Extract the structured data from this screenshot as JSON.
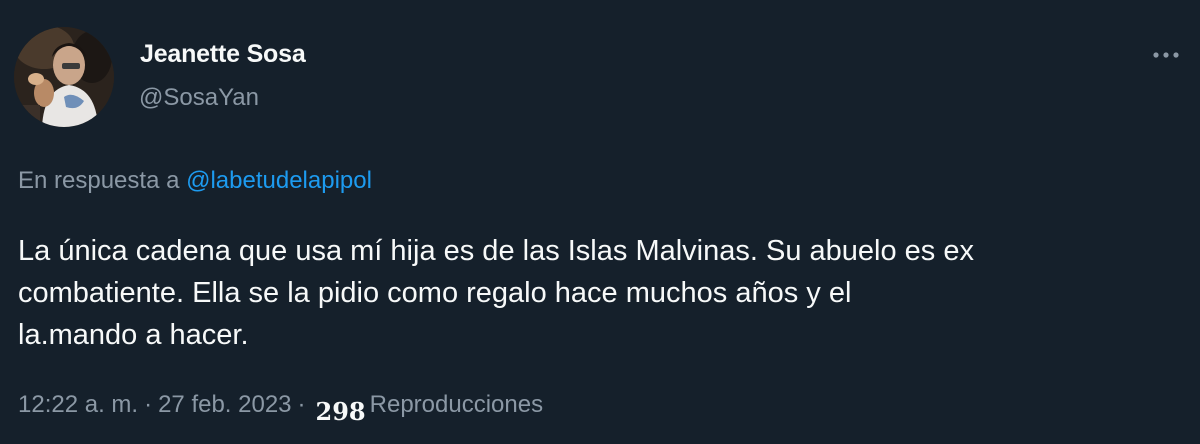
{
  "author": {
    "display_name": "Jeanette Sosa",
    "handle": "@SosaYan",
    "avatar_icon": "profile-photo"
  },
  "reply": {
    "prefix": "En respuesta a",
    "mention": "@labetudelapipol"
  },
  "tweet": {
    "lines": [
      "La única cadena que usa mí hija es de las Islas Malvinas. Su abuelo es ex",
      "combatiente. Ella se la pidio como regalo hace muchos años y el",
      "la.mando a hacer."
    ]
  },
  "meta": {
    "time": "12:22 a. m.",
    "separator": "·",
    "date": "27 feb. 2023",
    "views_count": "298",
    "views_label": "Reproducciones"
  },
  "menu": {
    "more_icon": "more-horizontal-icon"
  },
  "colors": {
    "background": "#15202b",
    "text": "#f7f9f9",
    "secondary": "#8b98a5",
    "link": "#1d9bf0"
  }
}
